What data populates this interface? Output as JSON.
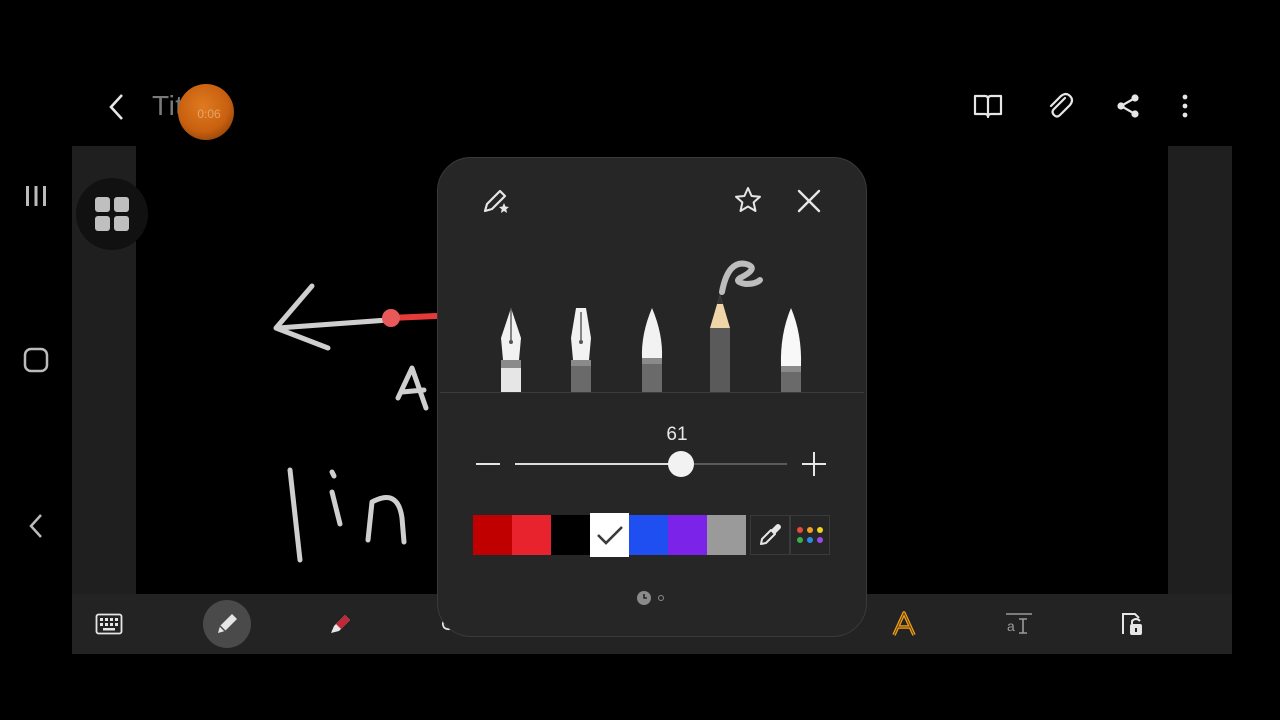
{
  "header": {
    "title": "Title",
    "recording_badge": "0:06"
  },
  "pen_settings": {
    "size_value": "61",
    "size_percent": 61,
    "pen_types": [
      "fountain-pen",
      "calligraphy-pen",
      "brush",
      "pencil",
      "highlighter"
    ],
    "selected_pen": "pencil",
    "colors": [
      "#c00000",
      "#e8232e",
      "#000000",
      "#ffffff",
      "#1f4ff0",
      "#7b23e8",
      "#9a9a9a"
    ],
    "selected_color": "#ffffff",
    "page_count": 2,
    "current_page": 1
  },
  "toolbar": {
    "items": [
      "keyboard",
      "pen",
      "eraser",
      "lasso",
      "text-style",
      "text-size",
      "lock"
    ],
    "active": "pen",
    "accent": "#f0a020"
  }
}
